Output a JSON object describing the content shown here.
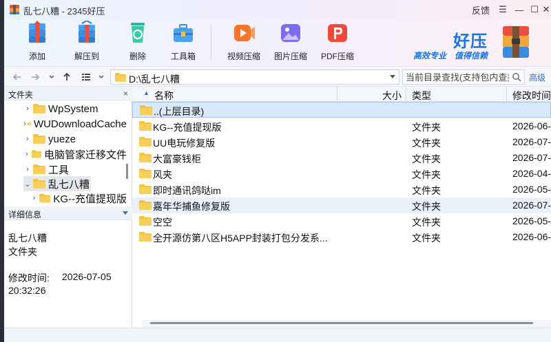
{
  "window": {
    "title": "乱七八糟 - 2345好压",
    "feedback": "反馈",
    "menu_glyph": "☰",
    "min_glyph": "—",
    "max_glyph": "☐",
    "close_glyph": "✕"
  },
  "toolbar": {
    "tools": [
      {
        "label": "添加",
        "icon": "add-archive-icon"
      },
      {
        "label": "解压到",
        "icon": "extract-icon"
      },
      {
        "label": "删除",
        "icon": "recycle-icon"
      },
      {
        "label": "工具箱",
        "icon": "toolbox-icon"
      },
      {
        "label": "视频压缩",
        "icon": "video-compress-icon"
      },
      {
        "label": "图片压缩",
        "icon": "image-compress-icon"
      },
      {
        "label": "PDF压缩",
        "icon": "pdf-compress-icon"
      }
    ],
    "brand": {
      "title": "好压",
      "slogan1": "高效专业",
      "slogan2": "值得信赖"
    }
  },
  "address": {
    "path": "D:\\乱七八糟",
    "search_placeholder": "当前目录查找(支持包内查找)",
    "advanced": "高级"
  },
  "left_panel": {
    "tree_header": "文件夹",
    "close_glyph": "×",
    "tree": [
      {
        "label": "WpSystem",
        "expanded": false
      },
      {
        "label": "WUDownloadCache",
        "expanded": false
      },
      {
        "label": "yueze",
        "expanded": false
      },
      {
        "label": "电脑管家迁移文件",
        "expanded": false
      },
      {
        "label": "工具",
        "expanded": false
      },
      {
        "label": "乱七八糟",
        "expanded": true,
        "selected": true
      },
      {
        "label": "KG--充值提现版",
        "expanded": false,
        "child": true
      }
    ],
    "details_header": "详细信息",
    "details": {
      "name": "乱七八糟",
      "type": "文件夹",
      "modified_label": "修改时间:",
      "modified_date": "2026-07-05",
      "modified_time": "20:32:26"
    }
  },
  "file_list": {
    "columns": {
      "name": "名称",
      "size": "大小",
      "type": "类型",
      "modified": "修改时间"
    },
    "up_row": "..(上层目录)",
    "rows": [
      {
        "name": "KG--充值提现版",
        "type": "文件夹",
        "modified": "2026-06-",
        "highlight": false
      },
      {
        "name": "UU电玩修复版",
        "type": "文件夹",
        "modified": "2026-07-",
        "highlight": false
      },
      {
        "name": "大富豪钱柜",
        "type": "文件夹",
        "modified": "2026-07-",
        "highlight": false
      },
      {
        "name": "风夹",
        "type": "文件夹",
        "modified": "2026-04-",
        "highlight": false
      },
      {
        "name": "即时通讯鸽哒im",
        "type": "文件夹",
        "modified": "2026-05-",
        "highlight": false
      },
      {
        "name": "嘉年华捕鱼修复版",
        "type": "文件夹",
        "modified": "2026-07-",
        "highlight": true
      },
      {
        "name": "空空",
        "type": "文件夹",
        "modified": "2026-05-",
        "highlight": false
      },
      {
        "name": "全开源仿第八区H5APP封装打包分发系...",
        "type": "文件夹",
        "modified": "2026-06-",
        "highlight": false
      }
    ]
  },
  "colors": {
    "accent": "#1a73e8",
    "folder": "#f5c242",
    "selection": "#d9e8f8"
  }
}
